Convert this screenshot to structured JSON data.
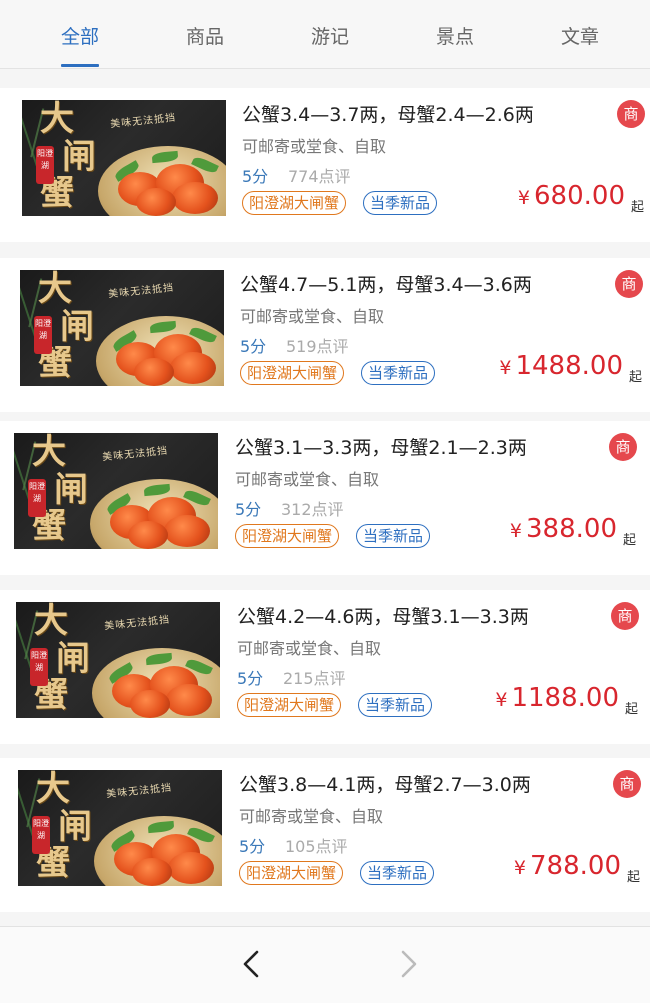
{
  "tabs": [
    {
      "label": "全部",
      "active": true
    },
    {
      "label": "商品",
      "active": false
    },
    {
      "label": "游记",
      "active": false
    },
    {
      "label": "景点",
      "active": false
    },
    {
      "label": "文章",
      "active": false
    }
  ],
  "colors": {
    "accent": "#2d6fc0",
    "price": "#d8262e",
    "badge": "#e5484d",
    "tag_orange": "#e0781e",
    "score": "#3a78b8"
  },
  "thumbnail": {
    "chars": [
      "大",
      "闸",
      "蟹"
    ],
    "seal": "阳澄湖",
    "slogan": "美味无法抵挡"
  },
  "products": [
    {
      "title": "公蟹3.4—3.7两，母蟹2.4—2.6两",
      "subtitle": "可邮寄或堂食、自取",
      "score": "5分",
      "reviews": "774点评",
      "tags": [
        "阳澄湖大闸蟹",
        "当季新品"
      ],
      "badge": "商",
      "currency": "¥",
      "price": "680.00",
      "suffix": "起"
    },
    {
      "title": "公蟹4.7—5.1两，母蟹3.4—3.6两",
      "subtitle": "可邮寄或堂食、自取",
      "score": "5分",
      "reviews": "519点评",
      "tags": [
        "阳澄湖大闸蟹",
        "当季新品"
      ],
      "badge": "商",
      "currency": "¥",
      "price": "1488.00",
      "suffix": "起"
    },
    {
      "title": "公蟹3.1—3.3两，母蟹2.1—2.3两",
      "subtitle": "可邮寄或堂食、自取",
      "score": "5分",
      "reviews": "312点评",
      "tags": [
        "阳澄湖大闸蟹",
        "当季新品"
      ],
      "badge": "商",
      "currency": "¥",
      "price": "388.00",
      "suffix": "起"
    },
    {
      "title": "公蟹4.2—4.6两，母蟹3.1—3.3两",
      "subtitle": "可邮寄或堂食、自取",
      "score": "5分",
      "reviews": "215点评",
      "tags": [
        "阳澄湖大闸蟹",
        "当季新品"
      ],
      "badge": "商",
      "currency": "¥",
      "price": "1188.00",
      "suffix": "起"
    },
    {
      "title": "公蟹3.8—4.1两，母蟹2.7—3.0两",
      "subtitle": "可邮寄或堂食、自取",
      "score": "5分",
      "reviews": "105点评",
      "tags": [
        "阳澄湖大闸蟹",
        "当季新品"
      ],
      "badge": "商",
      "currency": "¥",
      "price": "788.00",
      "suffix": "起"
    }
  ],
  "bottom_nav": {
    "back_icon": "chevron-left-icon",
    "forward_icon": "chevron-right-icon",
    "forward_enabled": false
  }
}
